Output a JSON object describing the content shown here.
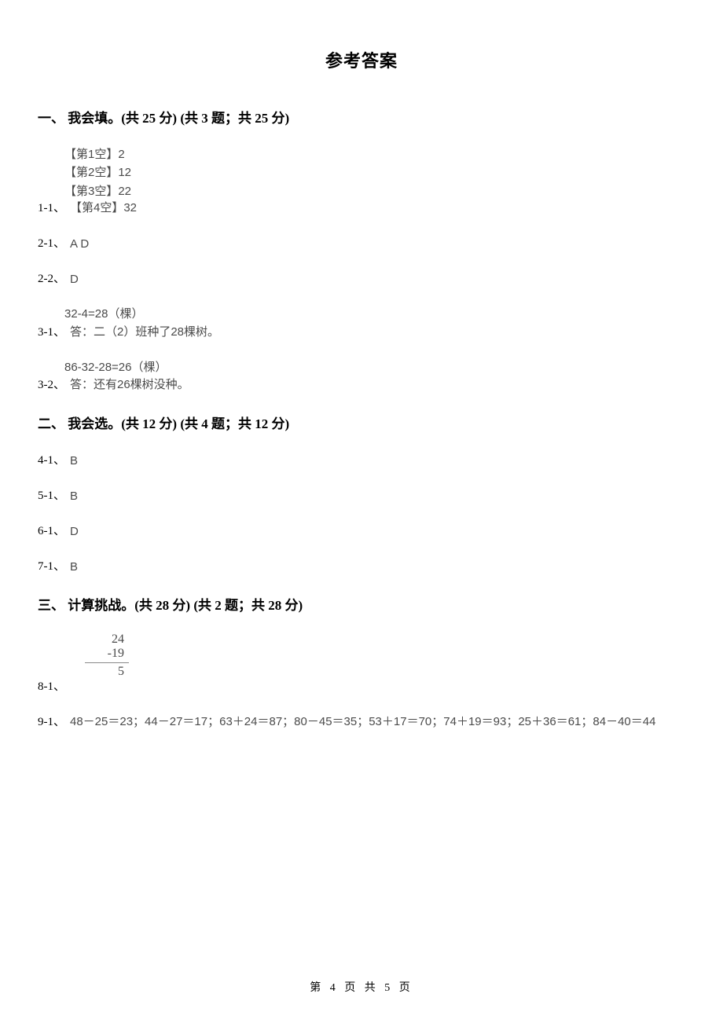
{
  "title": "参考答案",
  "section1": {
    "heading": "一、 我会填。(共 25 分)  (共 3 题；共 25 分)",
    "q1": {
      "num": "1-1、",
      "blank1": "【第1空】2",
      "blank2": "【第2空】12",
      "blank3": "【第3空】22",
      "blank4": "【第4空】32"
    },
    "q2_1": {
      "num": "2-1、",
      "ans": "A D"
    },
    "q2_2": {
      "num": "2-2、",
      "ans": "D"
    },
    "q3_1": {
      "num": "3-1、",
      "line1": "32-4=28（棵）",
      "line2": "答：二（2）班种了28棵树。"
    },
    "q3_2": {
      "num": "3-2、",
      "line1": "86-32-28=26（棵）",
      "line2": "答：还有26棵树没种。"
    }
  },
  "section2": {
    "heading": "二、 我会选。(共 12 分)  (共 4 题；共 12 分)",
    "q4_1": {
      "num": "4-1、",
      "ans": "B"
    },
    "q5_1": {
      "num": "5-1、",
      "ans": "B"
    },
    "q6_1": {
      "num": "6-1、",
      "ans": "D"
    },
    "q7_1": {
      "num": "7-1、",
      "ans": "B"
    }
  },
  "section3": {
    "heading": "三、 计算挑战。(共 28 分)  (共 2 题；共 28 分)",
    "q8_1": {
      "num": "8-1、",
      "top": "24",
      "mid": "-19",
      "bot": "5"
    },
    "q9_1": {
      "num": "9-1、",
      "ans": "48－25＝23；44－27＝17；63＋24＝87；80－45＝35；53＋17＝70；74＋19＝93；25＋36＝61；84－40＝44"
    }
  },
  "footer": "第 4 页 共 5 页"
}
